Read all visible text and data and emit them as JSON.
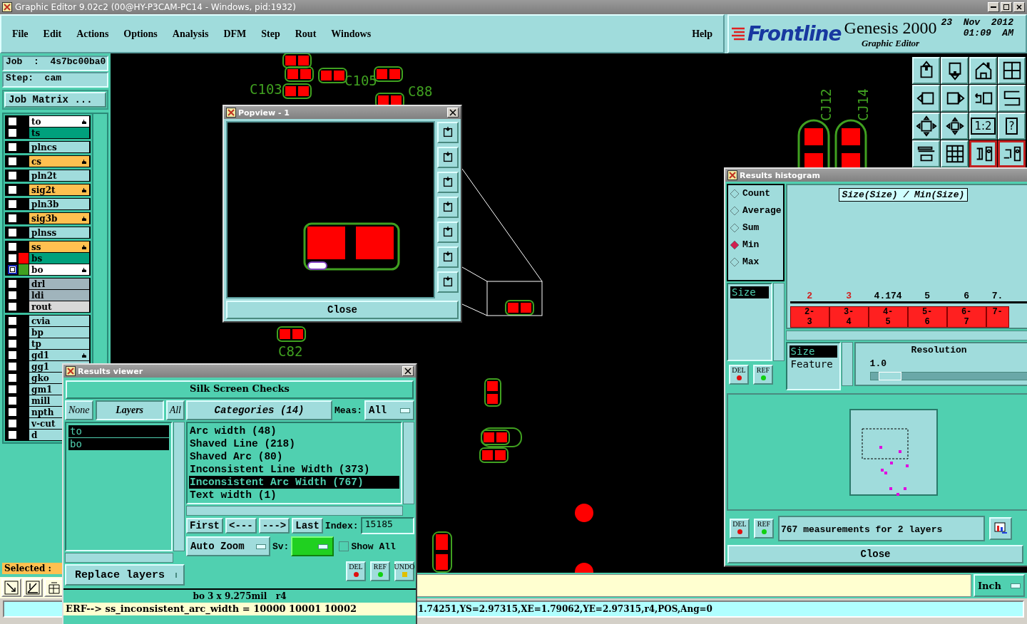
{
  "window": {
    "title": "Graphic Editor 9.02c2 (00@HY-P3CAM-PC14 - Windows, pid:1932)"
  },
  "menu": [
    "File",
    "Edit",
    "Actions",
    "Options",
    "Analysis",
    "DFM",
    "Step",
    "Rout",
    "Windows"
  ],
  "help": "Help",
  "brand": {
    "logo": "Frontline",
    "product": "Genesis 2000",
    "subtitle": "Graphic Editor",
    "date": "23  Nov  2012",
    "time": "01:09  AM"
  },
  "job": {
    "job": "Job  :  4s7bc00ba0",
    "step": "Step:  cam",
    "matrix_button": "Job Matrix ..."
  },
  "layer_groups": [
    [
      {
        "name": "to",
        "color": "#ffffff",
        "affected": true,
        "selected": false
      },
      {
        "name": "ts",
        "color": "#00a07c",
        "affected": false,
        "selected": false
      }
    ],
    [
      {
        "name": "plncs",
        "color": "#a0dcdc",
        "affected": false,
        "selected": false
      }
    ],
    [
      {
        "name": "cs",
        "color": "#ffc050",
        "affected": true,
        "selected": false
      }
    ],
    [
      {
        "name": "pln2t",
        "color": "#a0dcdc",
        "affected": false,
        "selected": false
      }
    ],
    [
      {
        "name": "sig2t",
        "color": "#ffc050",
        "affected": true,
        "selected": false
      }
    ],
    [
      {
        "name": "pln3b",
        "color": "#a0dcdc",
        "affected": false,
        "selected": false
      }
    ],
    [
      {
        "name": "sig3b",
        "color": "#ffc050",
        "affected": true,
        "selected": false
      }
    ],
    [
      {
        "name": "plnss",
        "color": "#a0dcdc",
        "affected": false,
        "selected": false
      }
    ],
    [
      {
        "name": "ss",
        "color": "#ffc050",
        "affected": true,
        "selected": false
      },
      {
        "name": "bs",
        "color": "#00a07c",
        "affected": false,
        "selected": false,
        "swatch": {
          "color": "#ff0000"
        }
      },
      {
        "name": "bo",
        "color": "#ffffff",
        "affected": true,
        "selected": true,
        "swatch": {
          "color": "#40a020"
        }
      }
    ],
    [
      {
        "name": "drl",
        "color": "#a0b4bc",
        "affected": false,
        "selected": false
      },
      {
        "name": "ldi",
        "color": "#a0b4bc",
        "affected": false,
        "selected": false
      },
      {
        "name": "rout",
        "color": "#d8d8d8",
        "affected": false,
        "selected": false
      }
    ],
    [
      {
        "name": "cvia",
        "color": "#a0dcdc",
        "affected": false,
        "selected": false
      },
      {
        "name": "bp",
        "color": "#a0dcdc",
        "affected": false,
        "selected": false
      },
      {
        "name": "tp",
        "color": "#a0dcdc",
        "affected": false,
        "selected": false
      },
      {
        "name": "gd1",
        "color": "#a0dcdc",
        "affected": true,
        "selected": false
      },
      {
        "name": "gg1",
        "color": "#a0dcdc",
        "selected": false
      },
      {
        "name": "gko",
        "color": "#a0dcdc",
        "selected": false
      },
      {
        "name": "gm1",
        "color": "#a0dcdc",
        "selected": false
      },
      {
        "name": "mill",
        "color": "#a0dcdc",
        "selected": false
      },
      {
        "name": "npth",
        "color": "#a0dcdc",
        "selected": false
      },
      {
        "name": "v-cut",
        "color": "#a0dcdc",
        "selected": false
      },
      {
        "name": "d",
        "color": "#a0dcdc",
        "selected": false
      }
    ]
  ],
  "selected_label": "Selected :",
  "pcb_labels": [
    "C103",
    "C105",
    "C88",
    "C82",
    "CJ12",
    "CJ14"
  ],
  "toolbar_labels": [
    "1:2",
    "?"
  ],
  "popview": {
    "title": "Popview - 1",
    "close": "Close"
  },
  "results_viewer": {
    "title": "Results viewer",
    "header": "Silk Screen Checks",
    "layer_buttons": [
      {
        "label": "None",
        "selected": false
      },
      {
        "label": "Layers",
        "selected": true
      },
      {
        "label": "All",
        "selected": false
      }
    ],
    "layers": [
      {
        "name": "to",
        "selected": true
      },
      {
        "name": "bo",
        "selected": true
      }
    ],
    "categories_button": "Categories (14)",
    "meas_label": "Meas:",
    "meas_value": "All",
    "categories": [
      {
        "name": "Arc width (48)",
        "selected": false
      },
      {
        "name": "Shaved Line (218)",
        "selected": false
      },
      {
        "name": "Shaved Arc (80)",
        "selected": false
      },
      {
        "name": "Inconsistent Line Width (373)",
        "selected": false
      },
      {
        "name": "Inconsistent Arc Width (767)",
        "selected": true
      },
      {
        "name": "Text width (1)",
        "selected": false
      }
    ],
    "nav": [
      "First",
      "<---",
      "--->",
      "Last"
    ],
    "index_label": "Index:",
    "index_value": "15185",
    "zoom_mode": "Auto Zoom",
    "sv_label": "Sv:",
    "show_all": {
      "label": "Show All",
      "checked": false
    },
    "replace_mode": "Replace layers",
    "actions": [
      "DEL",
      "REF",
      "UNDO"
    ],
    "info": "bo 3 x 9.275mil   r4",
    "erf": "ERF--> ss_inconsistent_arc_width = 10000 10001 10002"
  },
  "histogram": {
    "title": "Results histogram",
    "modes": [
      {
        "label": "Count",
        "selected": false
      },
      {
        "label": "Average",
        "selected": false
      },
      {
        "label": "Sum",
        "selected": false
      },
      {
        "label": "Min",
        "selected": true
      },
      {
        "label": "Max",
        "selected": false
      }
    ],
    "fields": [
      {
        "label": "Size",
        "selected": true
      }
    ],
    "field_actions": [
      "DEL",
      "REF"
    ],
    "chart_title": "Size(Size) / Min(Size)",
    "axis_labels": [
      {
        "label": "2",
        "highlighted": true
      },
      {
        "label": "3",
        "highlighted": true
      },
      {
        "label": "4.174",
        "highlighted": false
      },
      {
        "label": "5",
        "highlighted": false
      },
      {
        "label": "6",
        "highlighted": false
      },
      {
        "label": "7.",
        "highlighted": false
      }
    ],
    "bins": [
      [
        "2-",
        "3"
      ],
      [
        "3-",
        "4"
      ],
      [
        "4-",
        "5"
      ],
      [
        "5-",
        "6"
      ],
      [
        "6-",
        "7"
      ],
      [
        "7-"
      ]
    ],
    "group_by": [
      {
        "label": "Size",
        "selected": true
      },
      {
        "label": "Feature",
        "selected": false
      }
    ],
    "resolution_label": "Resolution",
    "resolution_value": "1.0",
    "resolution_level": {
      "level": 0.05
    },
    "actions": [
      "DEL",
      "REF"
    ],
    "summary": "767 measurements for 2 layers",
    "close": "Close"
  },
  "message_bar": {
    "units": "Inch"
  },
  "status_line": "1.74251,YS=2.97315,XE=1.79062,YE=2.97315,r4,POS,Ang=0"
}
